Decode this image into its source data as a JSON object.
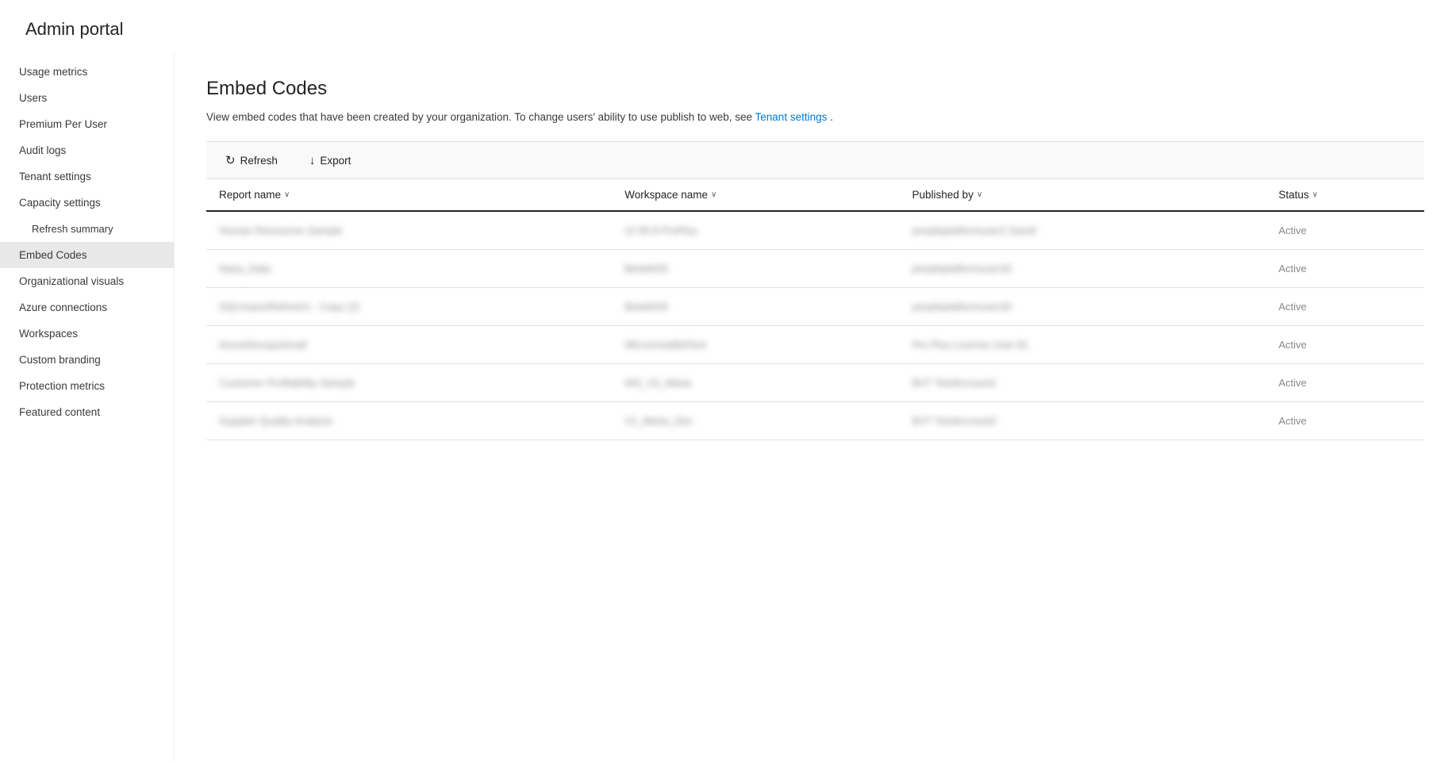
{
  "app": {
    "title": "Admin portal"
  },
  "sidebar": {
    "items": [
      {
        "id": "usage-metrics",
        "label": "Usage metrics",
        "active": false,
        "indented": false
      },
      {
        "id": "users",
        "label": "Users",
        "active": false,
        "indented": false
      },
      {
        "id": "premium-per-user",
        "label": "Premium Per User",
        "active": false,
        "indented": false
      },
      {
        "id": "audit-logs",
        "label": "Audit logs",
        "active": false,
        "indented": false
      },
      {
        "id": "tenant-settings",
        "label": "Tenant settings",
        "active": false,
        "indented": false
      },
      {
        "id": "capacity-settings",
        "label": "Capacity settings",
        "active": false,
        "indented": false
      },
      {
        "id": "refresh-summary",
        "label": "Refresh summary",
        "active": false,
        "indented": true
      },
      {
        "id": "embed-codes",
        "label": "Embed Codes",
        "active": true,
        "indented": false
      },
      {
        "id": "organizational-visuals",
        "label": "Organizational visuals",
        "active": false,
        "indented": false
      },
      {
        "id": "azure-connections",
        "label": "Azure connections",
        "active": false,
        "indented": false
      },
      {
        "id": "workspaces",
        "label": "Workspaces",
        "active": false,
        "indented": false
      },
      {
        "id": "custom-branding",
        "label": "Custom branding",
        "active": false,
        "indented": false
      },
      {
        "id": "protection-metrics",
        "label": "Protection metrics",
        "active": false,
        "indented": false
      },
      {
        "id": "featured-content",
        "label": "Featured content",
        "active": false,
        "indented": false
      }
    ]
  },
  "main": {
    "page_title": "Embed Codes",
    "description_text": "View embed codes that have been created by your organization. To change users' ability to use publish to web, see ",
    "description_link_text": "Tenant settings",
    "description_end": ".",
    "toolbar": {
      "refresh_label": "Refresh",
      "export_label": "Export"
    },
    "table": {
      "columns": [
        {
          "id": "report-name",
          "label": "Report name"
        },
        {
          "id": "workspace-name",
          "label": "Workspace name"
        },
        {
          "id": "published-by",
          "label": "Published by"
        },
        {
          "id": "status",
          "label": "Status"
        }
      ],
      "rows": [
        {
          "report_name": "Human Resources Sample",
          "workspace_name": "v2 90.8 ProPlus",
          "published_by": "peopleplatformuser2 Sara5",
          "status": "Active",
          "blurred": true
        },
        {
          "report_name": "Nasa_Data",
          "workspace_name": "BetaWS5",
          "published_by": "peopleplatformuser32",
          "status": "Active",
          "blurred": true
        },
        {
          "report_name": "SQLImportRefresh1 - Copy (2)",
          "workspace_name": "BetaWS5",
          "published_by": "peopleplatformuser32",
          "status": "Active",
          "blurred": true
        },
        {
          "report_name": "AzureDevopsSmall",
          "workspace_name": "IMLicenseBIdTest",
          "published_by": "Pro Plus License User 81",
          "status": "Active",
          "blurred": true
        },
        {
          "report_name": "Customer Profitability Sample",
          "workspace_name": "WS_V2_Maria",
          "published_by": "BVT TestAccount1",
          "status": "Active",
          "blurred": true
        },
        {
          "report_name": "Supplier Quality Analysis",
          "workspace_name": "V1_Maria_Dec",
          "published_by": "BVT TestAccount2",
          "status": "Active",
          "blurred": true
        }
      ]
    }
  }
}
